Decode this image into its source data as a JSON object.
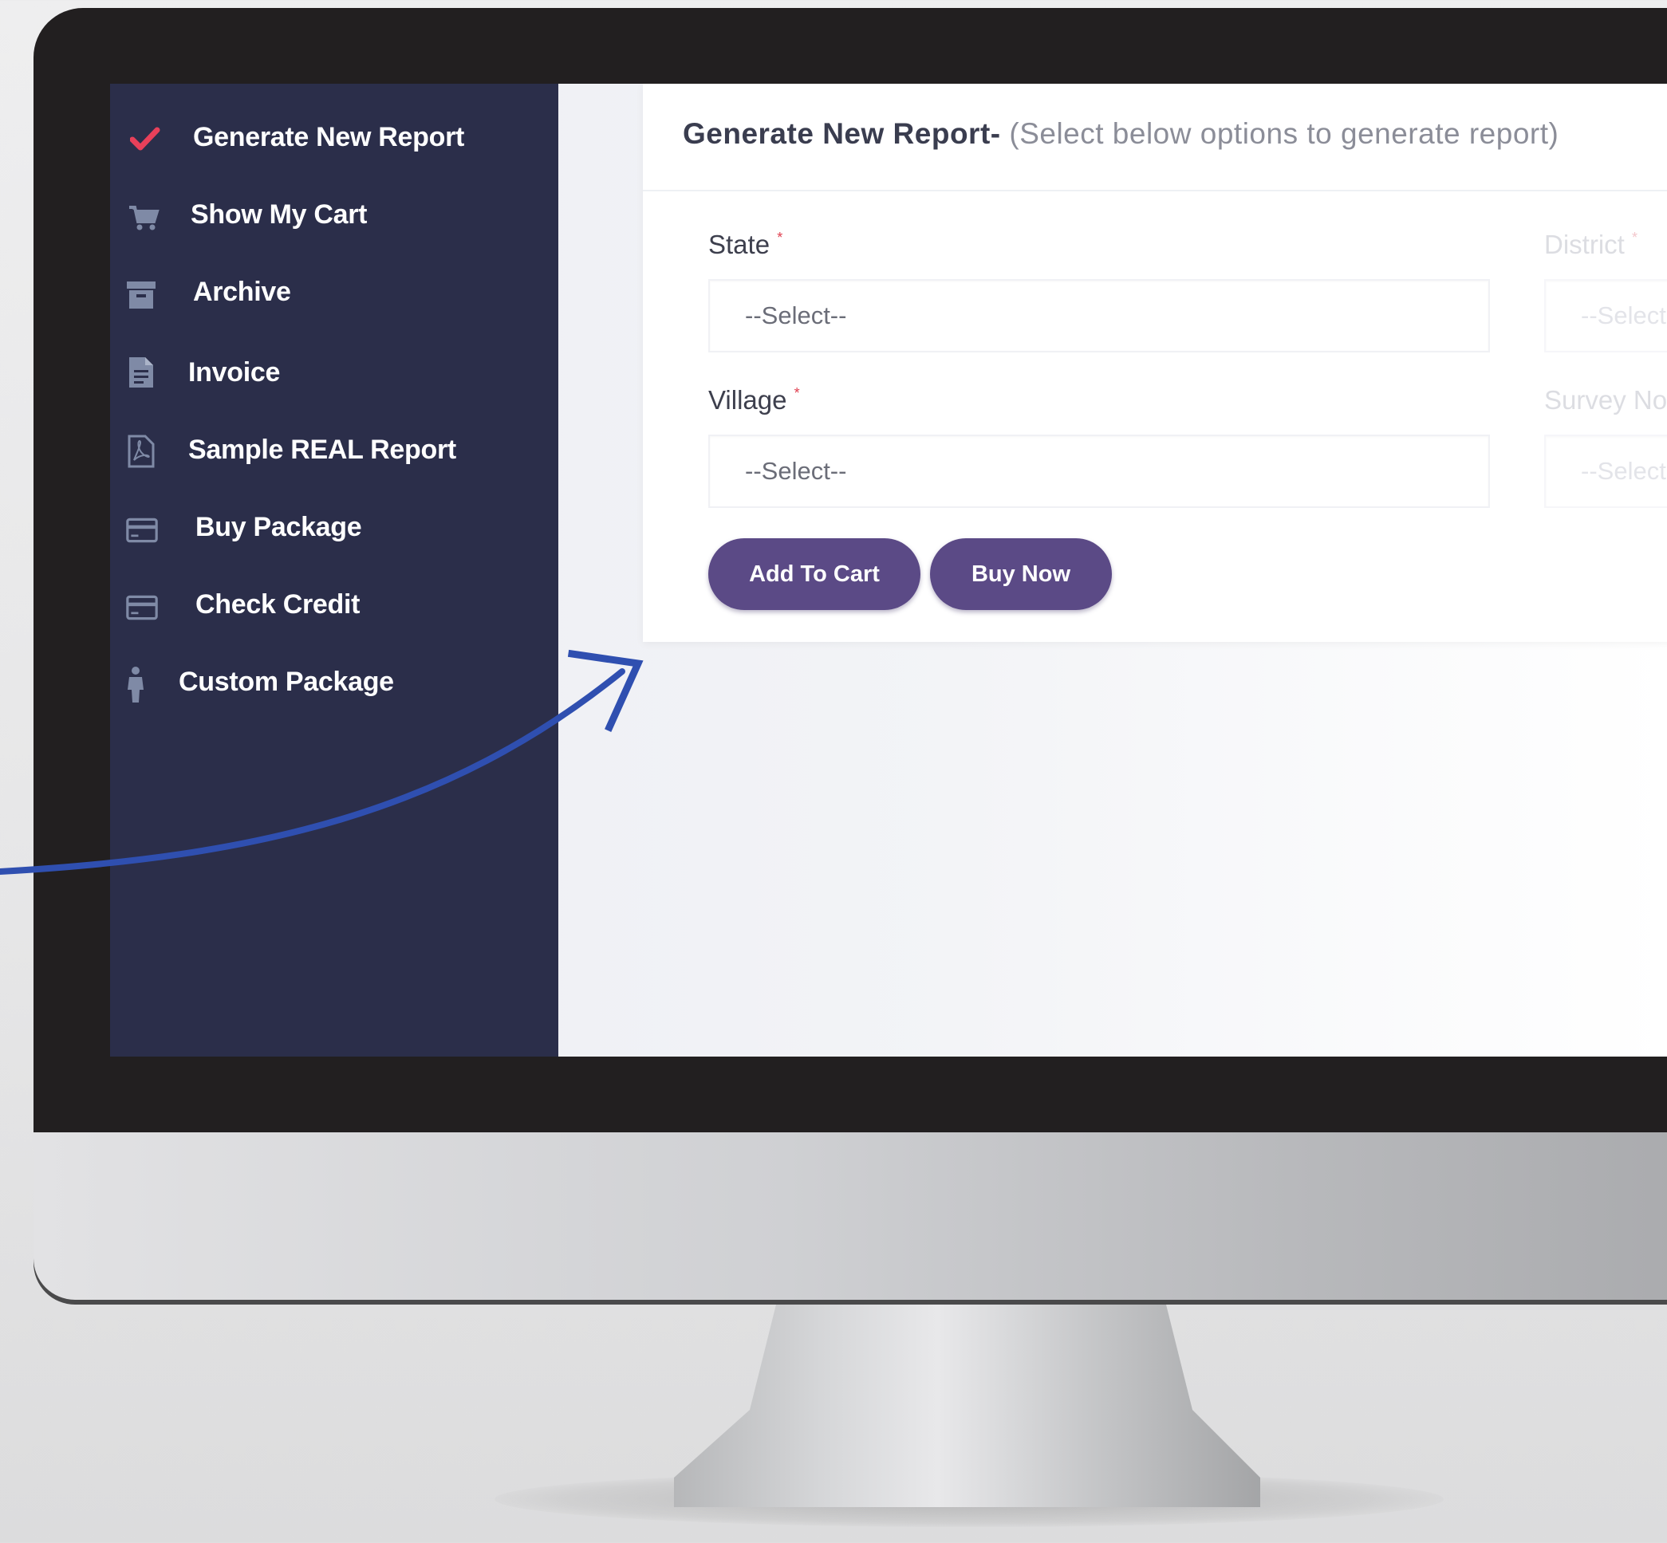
{
  "sidebar": {
    "items": [
      {
        "label": "Generate New Report",
        "icon": "check-icon"
      },
      {
        "label": "Show My Cart",
        "icon": "cart-icon"
      },
      {
        "label": "Archive",
        "icon": "archive-icon"
      },
      {
        "label": "Invoice",
        "icon": "document-icon"
      },
      {
        "label": "Sample REAL Report",
        "icon": "pdf-icon"
      },
      {
        "label": "Buy Package",
        "icon": "credit-card-icon"
      },
      {
        "label": "Check Credit",
        "icon": "credit-card-icon"
      },
      {
        "label": "Custom Package",
        "icon": "person-icon"
      }
    ]
  },
  "main": {
    "title": "Generate New Report-",
    "subtitle": "(Select below options to generate report)",
    "fields": {
      "state": {
        "label": "State",
        "value": "--Select--"
      },
      "district": {
        "label": "District",
        "value": "--Select--"
      },
      "village": {
        "label": "Village",
        "value": "--Select--"
      },
      "survey": {
        "label": "Survey No",
        "value": "--Select--"
      }
    },
    "required_mark": "*",
    "buttons": {
      "add_to_cart": "Add To Cart",
      "buy_now": "Buy Now"
    }
  },
  "colors": {
    "sidebar_bg": "#2b2e4a",
    "button_bg": "#5b4a86",
    "check_accent": "#e8405a",
    "arrow": "#2f4fb0"
  }
}
